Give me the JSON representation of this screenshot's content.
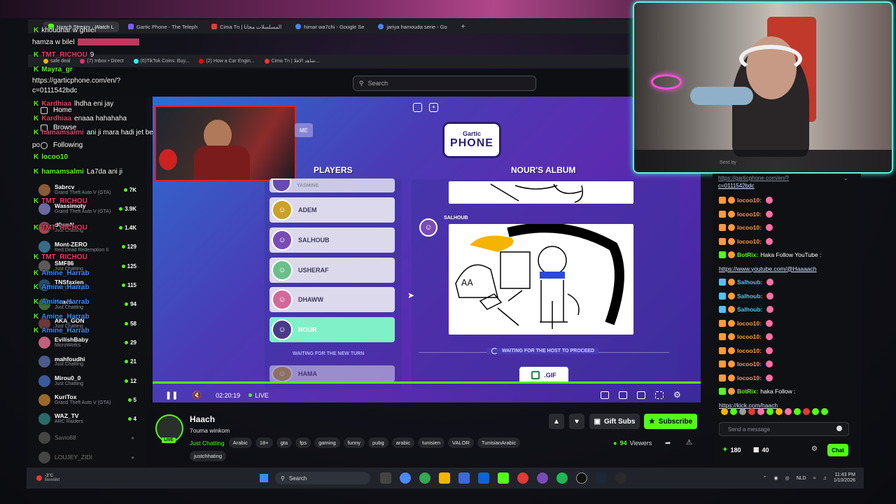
{
  "browser": {
    "tabs": [
      {
        "label": "Haach Stream - Watch L",
        "active": true,
        "color": "#53fc18"
      },
      {
        "label": "Gartic Phone - The Teleph",
        "active": false,
        "color": "#7b5cff"
      },
      {
        "label": "Cima Tn | المسلسلات مجانا",
        "active": false,
        "color": "#e53935"
      },
      {
        "label": "himar wa7chi - Google Se",
        "active": false,
        "color": "#4285f4"
      },
      {
        "label": "jariya hamouda serie - Go",
        "active": false,
        "color": "#4285f4"
      }
    ],
    "new_tab": "+",
    "bookmarks": [
      {
        "label": "safe deal",
        "color": "#f4b400"
      },
      {
        "label": "(7) Inbox • Direct",
        "color": "#e1306c"
      },
      {
        "label": "(6)TikTok Coins: Buy...",
        "color": "#25f4ee"
      },
      {
        "label": "(2) How a Car Engin...",
        "color": "#ff0000"
      },
      {
        "label": "Cima Tn | شاهد الافلا...",
        "color": "#e53935"
      }
    ]
  },
  "header": {
    "search_placeholder": "Search"
  },
  "sidebar": {
    "nav": [
      {
        "label": "Home"
      },
      {
        "label": "Browse"
      },
      {
        "label": "Following"
      }
    ],
    "channels": [
      {
        "name": "Sabrcv",
        "category": "Grand Theft Auto V (GTA)",
        "viewers": "7K",
        "color": "#8a5a3a"
      },
      {
        "name": "Wassimoty",
        "category": "Grand Theft Auto V (GTA)",
        "viewers": "3.9K",
        "color": "#6a6aa0"
      },
      {
        "name": "d0wnN",
        "category": "Just Chatting",
        "viewers": "1.4K",
        "color": "#a04a4a"
      },
      {
        "name": "Mont-ZERO",
        "category": "Red Dead Redemption II",
        "viewers": "129",
        "color": "#3a6a8a"
      },
      {
        "name": "SMF86",
        "category": "Just Chatting",
        "viewers": "125",
        "color": "#5a5a5a"
      },
      {
        "name": "TNSfaxien",
        "category": "Just Chatting",
        "viewers": "115",
        "color": "#2a4a6a"
      },
      {
        "name": "Haach",
        "category": "Just Chatting",
        "viewers": "94",
        "color": "#3d6b3d"
      },
      {
        "name": "AKA_GON",
        "category": "Just Chatting",
        "viewers": "58",
        "color": "#6a3a3a"
      },
      {
        "name": "EvilishBaby",
        "category": "MicroWorks",
        "viewers": "29",
        "color": "#c06080"
      },
      {
        "name": "mahfoudhi",
        "category": "Just Chatting",
        "viewers": "21",
        "color": "#4a5a8a"
      },
      {
        "name": "Mirou0_0",
        "category": "Just Chatting",
        "viewers": "12",
        "color": "#3a5a9a"
      },
      {
        "name": "KuriTox",
        "category": "Grand Theft Auto V (GTA)",
        "viewers": "5",
        "color": "#9a6a2a"
      },
      {
        "name": "WAZ_TV",
        "category": "ARC Raiders",
        "viewers": "4",
        "color": "#2a6a6a"
      },
      {
        "name": "Savio88",
        "category": "",
        "viewers": "",
        "color": "#444"
      },
      {
        "name": "LOUJEY_ZIDI",
        "category": "",
        "viewers": "",
        "color": "#444"
      }
    ]
  },
  "overlay_chat": [
    {
      "user": "",
      "text": "khoudhar w ghilel"
    },
    {
      "user": "",
      "text": "hamza w bilel"
    },
    {
      "user": "",
      "text": "9"
    },
    {
      "user": "Mayra_gr",
      "text": ""
    },
    {
      "user": "",
      "text": "https://garticphone.com/en/?"
    },
    {
      "user": "",
      "text": "c=0111542bdc"
    },
    {
      "user": "Kardhiaa",
      "text": "lhdha eni jay"
    },
    {
      "user": "Kardhiaa",
      "text": "enaaa hahahaha"
    },
    {
      "user": "hamamsalmi",
      "text": "ani ji mara hadi jet bel"
    },
    {
      "user": "",
      "text": "po"
    },
    {
      "user": "locoo10",
      "text": ""
    },
    {
      "user": "hamamsalmi",
      "text": "La7da ani ji"
    }
  ],
  "overlay_names": [
    "TMT_RICHOU",
    "TMT_RICHOU",
    "TMT_RICHOU",
    "TMT_RICHOU",
    "Amine_Harrab",
    "Amine_Harrab",
    "Amine_Harrab",
    "Amine_Harrab",
    "Amine_Harrab"
  ],
  "game": {
    "logo_top": "Gartic",
    "logo_bottom": "PHONE",
    "players_title": "PLAYERS",
    "album_title": "NOUR'S ALBUM",
    "me_label": "ME",
    "players": [
      {
        "name": "YASMINE",
        "selected": false
      },
      {
        "name": "ADEM",
        "selected": false
      },
      {
        "name": "SALHOUB",
        "selected": false
      },
      {
        "name": "USHERAF",
        "selected": false
      },
      {
        "name": "DHAWW",
        "selected": false
      },
      {
        "name": "NOUR",
        "selected": true
      },
      {
        "name": "HAMA",
        "selected": false
      }
    ],
    "waiting_turn": "WAITING FOR THE NEW TURN",
    "drawing_author": "SALHOUB",
    "waiting_host": "WAITING FOR THE HOST TO PROCEED",
    "gif_button": ".GIF"
  },
  "player_controls": {
    "time": "02:20:19",
    "live": "LIVE",
    "progress_fraction": 1.0
  },
  "stream": {
    "channel": "Haach",
    "title": "7ouma winkom",
    "category": "Just Chatting",
    "tags": [
      "Arabic",
      "18+",
      "gta",
      "fps",
      "gaming",
      "funny",
      "pubg",
      "arabic",
      "tunisien",
      "VALOR",
      "TunisianArabic",
      "justchhating"
    ],
    "gift_subs": "Gift Subs",
    "subscribe": "Subscribe",
    "viewers": "94",
    "viewers_label": "Viewers"
  },
  "cam": {
    "sent_by": "Sent by"
  },
  "chat": {
    "pinned_link": "https://garticphone.com/en/?",
    "pinned_link2": "c=0111542bdc",
    "messages": [
      {
        "user": "locoo10:",
        "text": "",
        "color": "#ff9a3c"
      },
      {
        "user": "locoo10:",
        "text": "",
        "color": "#ff9a3c"
      },
      {
        "user": "locoo10:",
        "text": "",
        "color": "#ff9a3c"
      },
      {
        "user": "locoo10:",
        "text": "",
        "color": "#ff9a3c"
      },
      {
        "user": "BotRix:",
        "text": "Haka Follow YouTube :",
        "color": "#53fc18"
      },
      {
        "user": "",
        "text": "https://www.youtube.com/@Haaaach",
        "color": "#cfe3ff"
      },
      {
        "user": "Salhoub:",
        "text": "",
        "color": "#4fc3f7"
      },
      {
        "user": "Salhoub:",
        "text": "",
        "color": "#4fc3f7"
      },
      {
        "user": "Salhoub:",
        "text": "",
        "color": "#4fc3f7"
      },
      {
        "user": "locoo10:",
        "text": "",
        "color": "#ff9a3c"
      },
      {
        "user": "locoo10:",
        "text": "",
        "color": "#ff9a3c"
      },
      {
        "user": "locoo10:",
        "text": "",
        "color": "#ff9a3c"
      },
      {
        "user": "locoo10:",
        "text": "",
        "color": "#ff9a3c"
      },
      {
        "user": "locoo10:",
        "text": "",
        "color": "#ff9a3c"
      },
      {
        "user": "BotRix:",
        "text": "haka Follow :",
        "color": "#53fc18"
      },
      {
        "user": "",
        "text": "https://kick.com/haach",
        "color": "#cfe3ff"
      }
    ],
    "input_placeholder": "Send a message",
    "points": "180",
    "count2": "40",
    "chat_button": "Chat"
  },
  "taskbar": {
    "weather_temp": "-3°C",
    "weather_text": "Bewolkt",
    "search": "Search",
    "lang": "NLD",
    "time": "11:43 PM",
    "date": "1/10/2026"
  },
  "colors": {
    "kick_green": "#53fc18",
    "cam_border": "#5ef3e0",
    "selected_player": "#7ff0c7"
  }
}
